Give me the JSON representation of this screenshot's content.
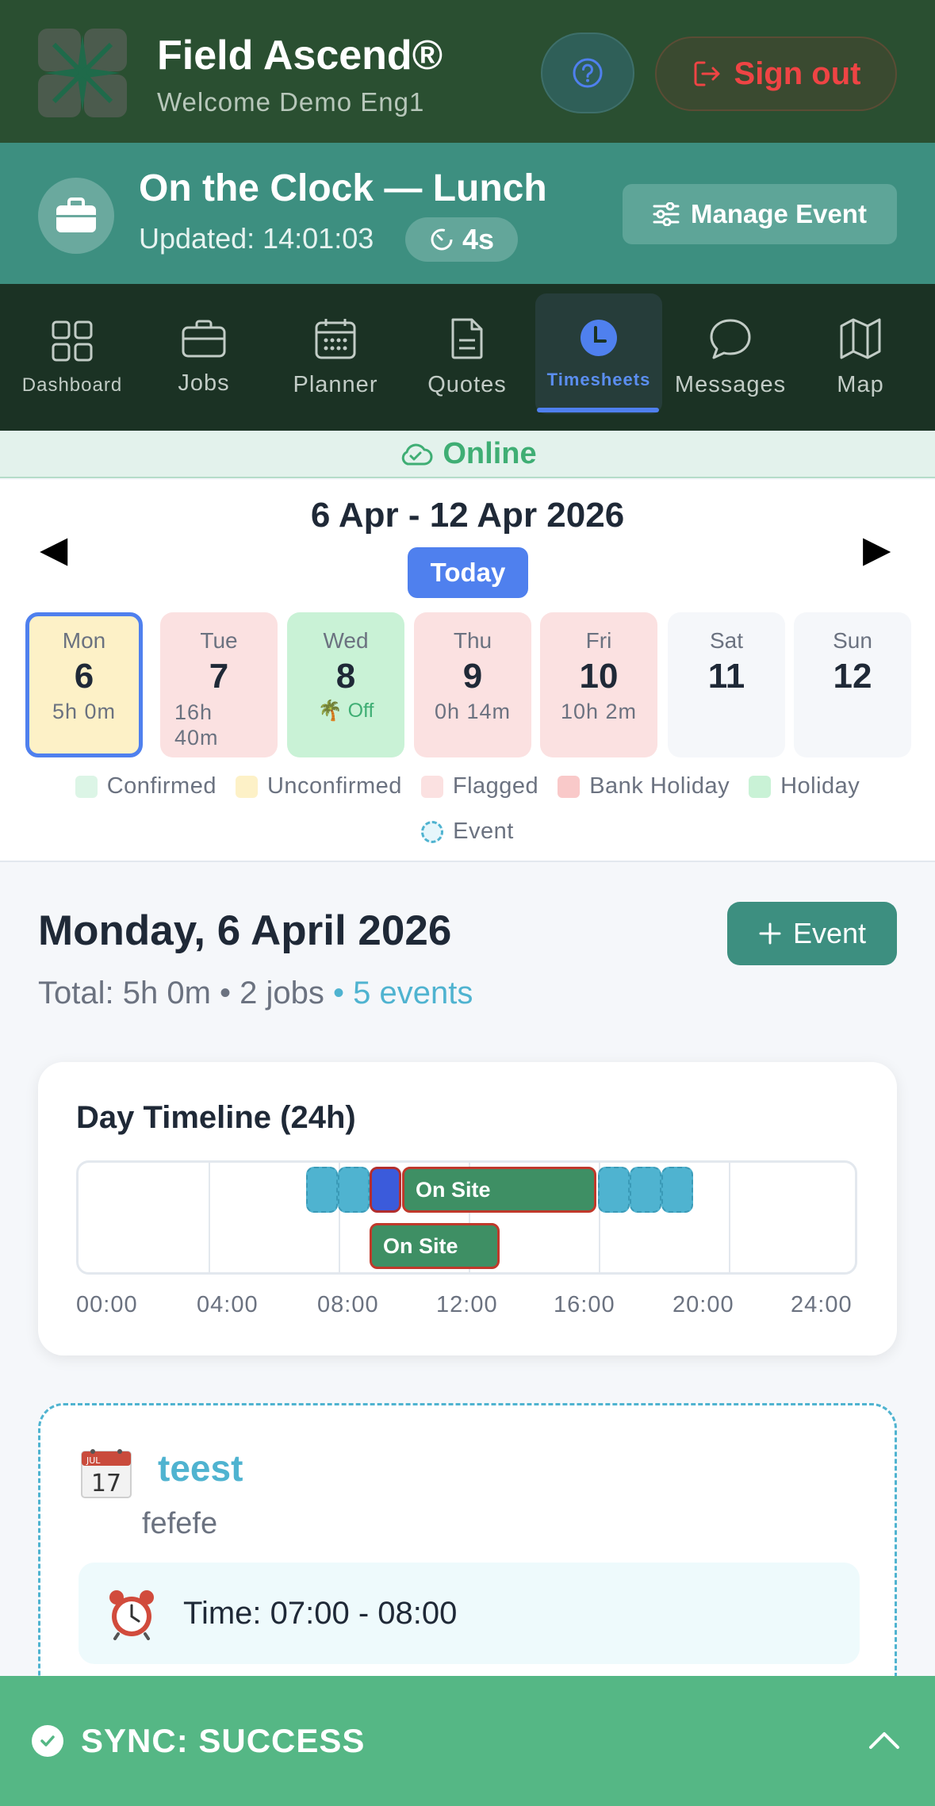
{
  "header": {
    "brand_title": "Field Ascend®",
    "brand_subtitle": "Welcome Demo Eng1",
    "signout_label": "Sign out"
  },
  "clock": {
    "title": "On the Clock — Lunch",
    "updated": "Updated: 14:01:03",
    "timer": "4s",
    "manage_label": "Manage Event"
  },
  "nav": {
    "items": [
      {
        "label": "Dashboard",
        "icon": "grid-icon"
      },
      {
        "label": "Jobs",
        "icon": "briefcase-icon"
      },
      {
        "label": "Planner",
        "icon": "calendar-icon"
      },
      {
        "label": "Quotes",
        "icon": "document-icon"
      },
      {
        "label": "Timesheets",
        "icon": "clock-icon",
        "active": true
      },
      {
        "label": "Messages",
        "icon": "chat-icon"
      },
      {
        "label": "Map",
        "icon": "map-icon"
      }
    ]
  },
  "status": {
    "online": "Online"
  },
  "week": {
    "range": "6 Apr - 12 Apr 2026",
    "prev_arrow": "◀",
    "next_arrow": "▶",
    "today_label": "Today",
    "days": [
      {
        "name": "Mon",
        "num": "6",
        "hours": "5h 0m",
        "status": "unconfirmed",
        "selected": true
      },
      {
        "name": "Tue",
        "num": "7",
        "hours": "16h 40m",
        "status": "flagged"
      },
      {
        "name": "Wed",
        "num": "8",
        "hours": "🌴 Off",
        "status": "holiday"
      },
      {
        "name": "Thu",
        "num": "9",
        "hours": "0h 14m",
        "status": "flagged"
      },
      {
        "name": "Fri",
        "num": "10",
        "hours": "10h 2m",
        "status": "flagged"
      },
      {
        "name": "Sat",
        "num": "11",
        "hours": "",
        "status": "none"
      },
      {
        "name": "Sun",
        "num": "12",
        "hours": "",
        "status": "none"
      }
    ],
    "legend": [
      {
        "label": "Confirmed",
        "color": "#dcf5e6"
      },
      {
        "label": "Unconfirmed",
        "color": "#fdf1c7"
      },
      {
        "label": "Flagged",
        "color": "#fbe1e1"
      },
      {
        "label": "Bank Holiday",
        "color": "#f9c9c9"
      },
      {
        "label": "Holiday",
        "color": "#c9f2d6"
      },
      {
        "label": "Event",
        "color": "#4fb3d0"
      }
    ]
  },
  "day": {
    "title": "Monday, 6 April 2026",
    "add_event_label": "Event",
    "total": "Total: 5h 0m",
    "jobs": "2 jobs",
    "events": "5 events"
  },
  "timeline": {
    "title": "Day Timeline (24h)",
    "ticks": [
      "00:00",
      "04:00",
      "08:00",
      "12:00",
      "16:00",
      "20:00",
      "24:00"
    ],
    "site_label": "On Site",
    "site_label_2": "On Site"
  },
  "event_card": {
    "title": "teest",
    "description": "fefefe",
    "time": "Time: 07:00 - 08:00",
    "calendar_month": "JUL",
    "calendar_day": "17"
  },
  "sync": {
    "text": "SYNC: SUCCESS"
  },
  "colors": {
    "header_bg": "#2a4f31",
    "banner_bg": "#3d8f80",
    "nav_bg": "#1b3224",
    "accent_blue": "#4f80ee",
    "event_blue": "#4fb3d0",
    "sync_green": "#55b785"
  }
}
